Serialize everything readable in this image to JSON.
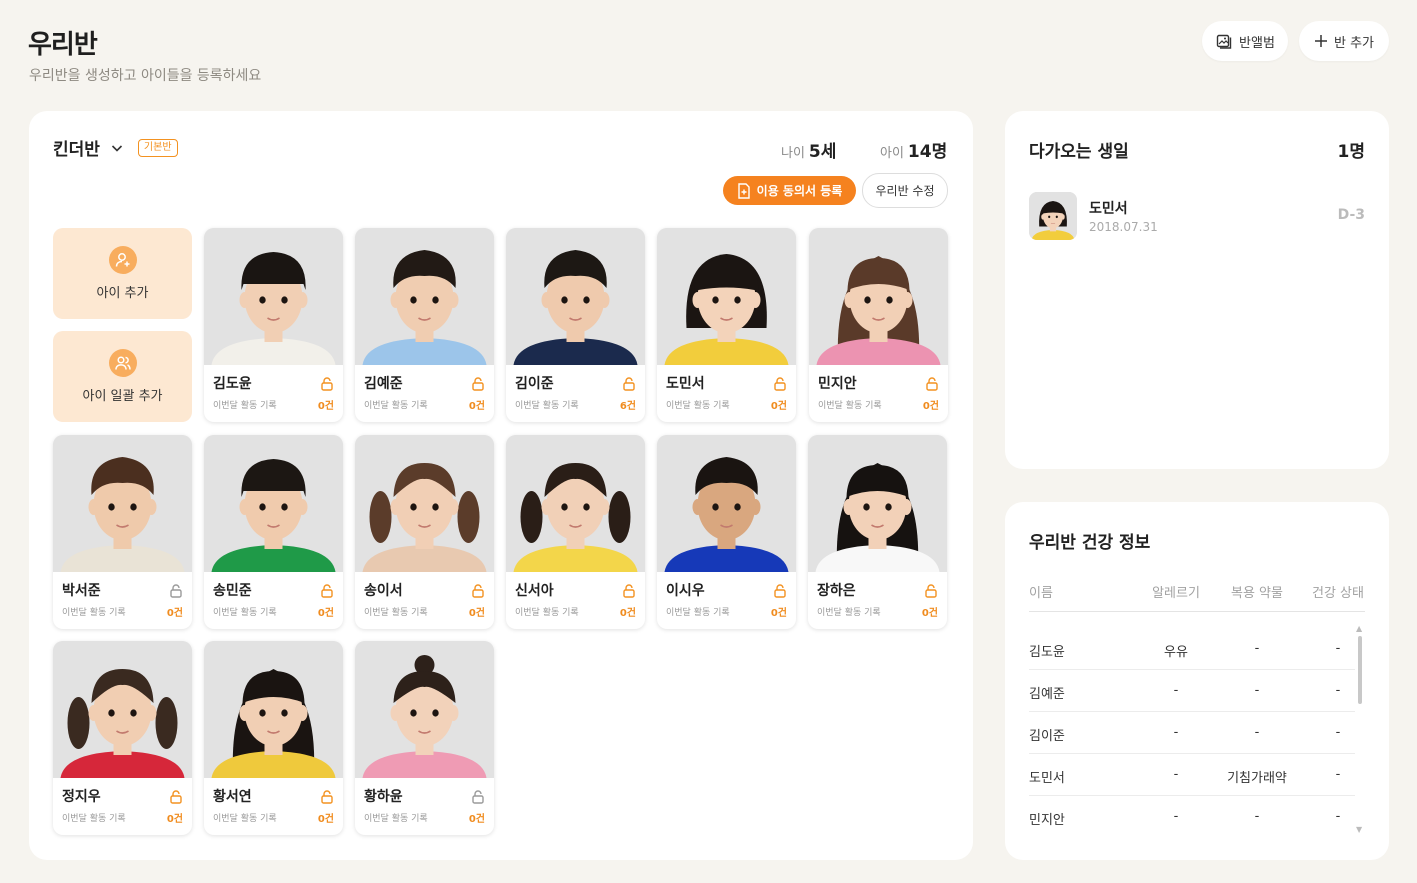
{
  "header": {
    "title": "우리반",
    "subtitle": "우리반을 생성하고 아이들을 등록하세요",
    "album_label": "반앨범",
    "add_class_label": "반 추가"
  },
  "class_panel": {
    "class_name": "킨더반",
    "default_badge": "기본반",
    "age_label": "나이",
    "age_value": "5세",
    "kids_label": "아이",
    "kids_value": "14명",
    "consent_button": "이용 동의서 등록",
    "edit_button": "우리반 수정",
    "add_child_label": "아이 추가",
    "add_bulk_label": "아이 일괄 추가"
  },
  "children": [
    {
      "name": "김도윤",
      "sub": "이번달 활동 기록",
      "count": "0건",
      "lock": "orange",
      "hair": "#1a1512",
      "shirt": "#f2f0ea",
      "skin": "#f1cfb4",
      "style": "bowl"
    },
    {
      "name": "김예준",
      "sub": "이번달 활동 기록",
      "count": "0건",
      "lock": "orange",
      "hair": "#221a15",
      "shirt": "#9cc5ea",
      "skin": "#f0cdb1",
      "style": "spiky"
    },
    {
      "name": "김이준",
      "sub": "이번달 활동 기록",
      "count": "6건",
      "lock": "orange",
      "hair": "#1d1814",
      "shirt": "#1b2a4d",
      "skin": "#efcaad",
      "style": "spiky"
    },
    {
      "name": "도민서",
      "sub": "이번달 활동 기록",
      "count": "0건",
      "lock": "orange",
      "hair": "#1b1512",
      "shirt": "#f2cd3c",
      "skin": "#f3d3ba",
      "style": "bob"
    },
    {
      "name": "민지안",
      "sub": "이번달 활동 기록",
      "count": "0건",
      "lock": "orange",
      "hair": "#5a3a29",
      "shirt": "#ec93b1",
      "skin": "#f2d0b6",
      "style": "long"
    },
    {
      "name": "박서준",
      "sub": "이번달 활동 기록",
      "count": "0건",
      "lock": "gray",
      "hair": "#4b2f1f",
      "shirt": "#e9e3d6",
      "skin": "#efcaab",
      "style": "messy"
    },
    {
      "name": "송민준",
      "sub": "이번달 활동 기록",
      "count": "0건",
      "lock": "orange",
      "hair": "#1c1713",
      "shirt": "#1f9a48",
      "skin": "#f0cbad",
      "style": "bowl"
    },
    {
      "name": "송이서",
      "sub": "이번달 활동 기록",
      "count": "0건",
      "lock": "orange",
      "hair": "#5b3c2a",
      "shirt": "#e8c9b0",
      "skin": "#f1cfb5",
      "style": "pigtail"
    },
    {
      "name": "신서아",
      "sub": "이번달 활동 기록",
      "count": "0건",
      "lock": "orange",
      "hair": "#2a1e17",
      "shirt": "#f3d64a",
      "skin": "#f1d0b7",
      "style": "pigtail"
    },
    {
      "name": "이시우",
      "sub": "이번달 활동 기록",
      "count": "0건",
      "lock": "orange",
      "hair": "#1a1411",
      "shirt": "#1639b8",
      "skin": "#d9a77f",
      "style": "curly"
    },
    {
      "name": "장하은",
      "sub": "이번달 활동 기록",
      "count": "0건",
      "lock": "orange",
      "hair": "#161210",
      "shirt": "#f8f8f8",
      "skin": "#f2d1b8",
      "style": "long"
    },
    {
      "name": "정지우",
      "sub": "이번달 활동 기록",
      "count": "0건",
      "lock": "orange",
      "hair": "#3a2a20",
      "shirt": "#d6273a",
      "skin": "#f1ceb2",
      "style": "pigtail"
    },
    {
      "name": "황서연",
      "sub": "이번달 활동 기록",
      "count": "0건",
      "lock": "orange",
      "hair": "#1a1411",
      "shirt": "#efc93c",
      "skin": "#f1cfb4",
      "style": "long"
    },
    {
      "name": "황하윤",
      "sub": "이번달 활동 기록",
      "count": "0건",
      "lock": "gray",
      "hair": "#2d211a",
      "shirt": "#ef9bb4",
      "skin": "#f2d2ba",
      "style": "bun"
    }
  ],
  "birthday": {
    "title": "다가오는 생일",
    "count": "1명",
    "name": "도민서",
    "date": "2018.07.31",
    "dday": "D-3"
  },
  "health": {
    "title": "우리반 건강 정보",
    "columns": [
      "이름",
      "알레르기",
      "복용 약물",
      "건강 상태"
    ],
    "rows": [
      {
        "name": "김도윤",
        "allergy": "우유",
        "med": "-",
        "health": "-"
      },
      {
        "name": "김예준",
        "allergy": "-",
        "med": "-",
        "health": "-"
      },
      {
        "name": "김이준",
        "allergy": "-",
        "med": "-",
        "health": "-"
      },
      {
        "name": "도민서",
        "allergy": "-",
        "med": "기침가래약",
        "health": "-"
      },
      {
        "name": "민지안",
        "allergy": "-",
        "med": "-",
        "health": "-"
      }
    ]
  },
  "colors": {
    "accent": "#f5821f",
    "tile_bg": "#fde8d2",
    "page_bg": "#f6f4ef"
  }
}
